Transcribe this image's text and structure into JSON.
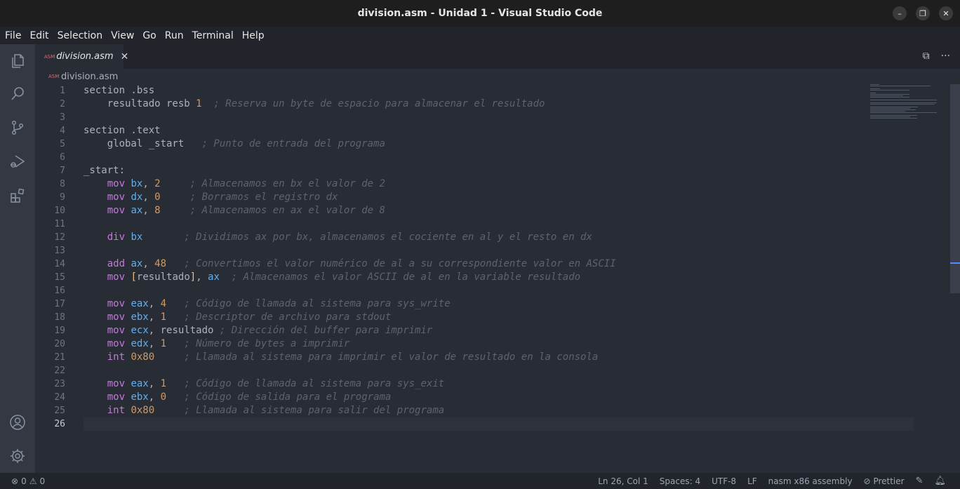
{
  "window": {
    "title": "division.asm - Unidad 1 - Visual Studio Code",
    "controls": {
      "minimize": "–",
      "maximize": "❐",
      "close": "✕"
    }
  },
  "menu": [
    "File",
    "Edit",
    "Selection",
    "View",
    "Go",
    "Run",
    "Terminal",
    "Help"
  ],
  "activity_bar": [
    "explorer-icon",
    "search-icon",
    "source-control-icon",
    "run-debug-icon",
    "extensions-icon",
    "account-icon",
    "gear-icon"
  ],
  "tab": {
    "icon_text": "ASM",
    "label": "division.asm",
    "close": "✕"
  },
  "tab_actions": {
    "split": "⧉",
    "more": "···"
  },
  "breadcrumb": {
    "icon_text": "ASM",
    "file": "division.asm"
  },
  "editor": {
    "current_line": 26,
    "lines": [
      {
        "num": "1",
        "tokens": [
          [
            "p",
            "section .bss"
          ]
        ]
      },
      {
        "num": "2",
        "tokens": [
          [
            "p",
            "    resultado resb "
          ],
          [
            "n",
            "1"
          ],
          [
            "p",
            "  "
          ],
          [
            "c",
            "; Reserva un byte de espacio para almacenar el resultado"
          ]
        ]
      },
      {
        "num": "3",
        "tokens": []
      },
      {
        "num": "4",
        "tokens": [
          [
            "p",
            "section .text"
          ]
        ]
      },
      {
        "num": "5",
        "tokens": [
          [
            "p",
            "    global _start   "
          ],
          [
            "c",
            "; Punto de entrada del programa"
          ]
        ]
      },
      {
        "num": "6",
        "tokens": []
      },
      {
        "num": "7",
        "tokens": [
          [
            "p",
            "_start:"
          ]
        ]
      },
      {
        "num": "8",
        "tokens": [
          [
            "p",
            "    "
          ],
          [
            "k",
            "mov"
          ],
          [
            "p",
            " "
          ],
          [
            "r",
            "bx"
          ],
          [
            "p",
            ", "
          ],
          [
            "n",
            "2"
          ],
          [
            "p",
            "     "
          ],
          [
            "c",
            "; Almacenamos en bx el valor de 2"
          ]
        ]
      },
      {
        "num": "9",
        "tokens": [
          [
            "p",
            "    "
          ],
          [
            "k",
            "mov"
          ],
          [
            "p",
            " "
          ],
          [
            "r",
            "dx"
          ],
          [
            "p",
            ", "
          ],
          [
            "n",
            "0"
          ],
          [
            "p",
            "     "
          ],
          [
            "c",
            "; Borramos el registro dx"
          ]
        ]
      },
      {
        "num": "10",
        "tokens": [
          [
            "p",
            "    "
          ],
          [
            "k",
            "mov"
          ],
          [
            "p",
            " "
          ],
          [
            "r",
            "ax"
          ],
          [
            "p",
            ", "
          ],
          [
            "n",
            "8"
          ],
          [
            "p",
            "     "
          ],
          [
            "c",
            "; Almacenamos en ax el valor de 8"
          ]
        ]
      },
      {
        "num": "11",
        "tokens": []
      },
      {
        "num": "12",
        "tokens": [
          [
            "p",
            "    "
          ],
          [
            "k",
            "div"
          ],
          [
            "p",
            " "
          ],
          [
            "r",
            "bx"
          ],
          [
            "p",
            "       "
          ],
          [
            "c",
            "; Dividimos ax por bx, almacenamos el cociente en al y el resto en dx"
          ]
        ]
      },
      {
        "num": "13",
        "tokens": []
      },
      {
        "num": "14",
        "tokens": [
          [
            "p",
            "    "
          ],
          [
            "k",
            "add"
          ],
          [
            "p",
            " "
          ],
          [
            "r",
            "ax"
          ],
          [
            "p",
            ", "
          ],
          [
            "n",
            "48"
          ],
          [
            "p",
            "   "
          ],
          [
            "c",
            "; Convertimos el valor numérico de al a su correspondiente valor en ASCII"
          ]
        ]
      },
      {
        "num": "15",
        "tokens": [
          [
            "p",
            "    "
          ],
          [
            "k",
            "mov"
          ],
          [
            "p",
            " "
          ],
          [
            "b",
            "["
          ],
          [
            "p",
            "resultado"
          ],
          [
            "b",
            "]"
          ],
          [
            "p",
            ", "
          ],
          [
            "r",
            "ax"
          ],
          [
            "p",
            "  "
          ],
          [
            "c",
            "; Almacenamos el valor ASCII de al en la variable resultado"
          ]
        ]
      },
      {
        "num": "16",
        "tokens": []
      },
      {
        "num": "17",
        "tokens": [
          [
            "p",
            "    "
          ],
          [
            "k",
            "mov"
          ],
          [
            "p",
            " "
          ],
          [
            "r",
            "eax"
          ],
          [
            "p",
            ", "
          ],
          [
            "n",
            "4"
          ],
          [
            "p",
            "   "
          ],
          [
            "c",
            "; Código de llamada al sistema para sys_write"
          ]
        ]
      },
      {
        "num": "18",
        "tokens": [
          [
            "p",
            "    "
          ],
          [
            "k",
            "mov"
          ],
          [
            "p",
            " "
          ],
          [
            "r",
            "ebx"
          ],
          [
            "p",
            ", "
          ],
          [
            "n",
            "1"
          ],
          [
            "p",
            "   "
          ],
          [
            "c",
            "; Descriptor de archivo para stdout"
          ]
        ]
      },
      {
        "num": "19",
        "tokens": [
          [
            "p",
            "    "
          ],
          [
            "k",
            "mov"
          ],
          [
            "p",
            " "
          ],
          [
            "r",
            "ecx"
          ],
          [
            "p",
            ", resultado "
          ],
          [
            "c",
            "; Dirección del buffer para imprimir"
          ]
        ]
      },
      {
        "num": "20",
        "tokens": [
          [
            "p",
            "    "
          ],
          [
            "k",
            "mov"
          ],
          [
            "p",
            " "
          ],
          [
            "r",
            "edx"
          ],
          [
            "p",
            ", "
          ],
          [
            "n",
            "1"
          ],
          [
            "p",
            "   "
          ],
          [
            "c",
            "; Número de bytes a imprimir"
          ]
        ]
      },
      {
        "num": "21",
        "tokens": [
          [
            "p",
            "    "
          ],
          [
            "k",
            "int"
          ],
          [
            "p",
            " "
          ],
          [
            "n",
            "0x80"
          ],
          [
            "p",
            "     "
          ],
          [
            "c",
            "; Llamada al sistema para imprimir el valor de resultado en la consola"
          ]
        ]
      },
      {
        "num": "22",
        "tokens": []
      },
      {
        "num": "23",
        "tokens": [
          [
            "p",
            "    "
          ],
          [
            "k",
            "mov"
          ],
          [
            "p",
            " "
          ],
          [
            "r",
            "eax"
          ],
          [
            "p",
            ", "
          ],
          [
            "n",
            "1"
          ],
          [
            "p",
            "   "
          ],
          [
            "c",
            "; Código de llamada al sistema para sys_exit"
          ]
        ]
      },
      {
        "num": "24",
        "tokens": [
          [
            "p",
            "    "
          ],
          [
            "k",
            "mov"
          ],
          [
            "p",
            " "
          ],
          [
            "r",
            "ebx"
          ],
          [
            "p",
            ", "
          ],
          [
            "n",
            "0"
          ],
          [
            "p",
            "   "
          ],
          [
            "c",
            "; Código de salida para el programa"
          ]
        ]
      },
      {
        "num": "25",
        "tokens": [
          [
            "p",
            "    "
          ],
          [
            "k",
            "int"
          ],
          [
            "p",
            " "
          ],
          [
            "n",
            "0x80"
          ],
          [
            "p",
            "     "
          ],
          [
            "c",
            "; Llamada al sistema para salir del programa"
          ]
        ]
      },
      {
        "num": "26",
        "tokens": []
      }
    ]
  },
  "status": {
    "errors_icon": "⊗",
    "errors": "0",
    "warnings_icon": "⚠",
    "warnings": "0",
    "position": "Ln 26, Col 1",
    "spaces": "Spaces: 4",
    "encoding": "UTF-8",
    "eol": "LF",
    "language": "nasm x86 assembly",
    "prettier_icon": "⊘",
    "prettier": "Prettier",
    "feedback_icon": "✎",
    "bell_icon": "🔔︎"
  },
  "colors": {
    "keyword": "#c678dd",
    "register": "#61afef",
    "number": "#d19a66",
    "comment": "#5c6370",
    "bracket": "#e5c07b",
    "editor_bg": "#282c34"
  }
}
